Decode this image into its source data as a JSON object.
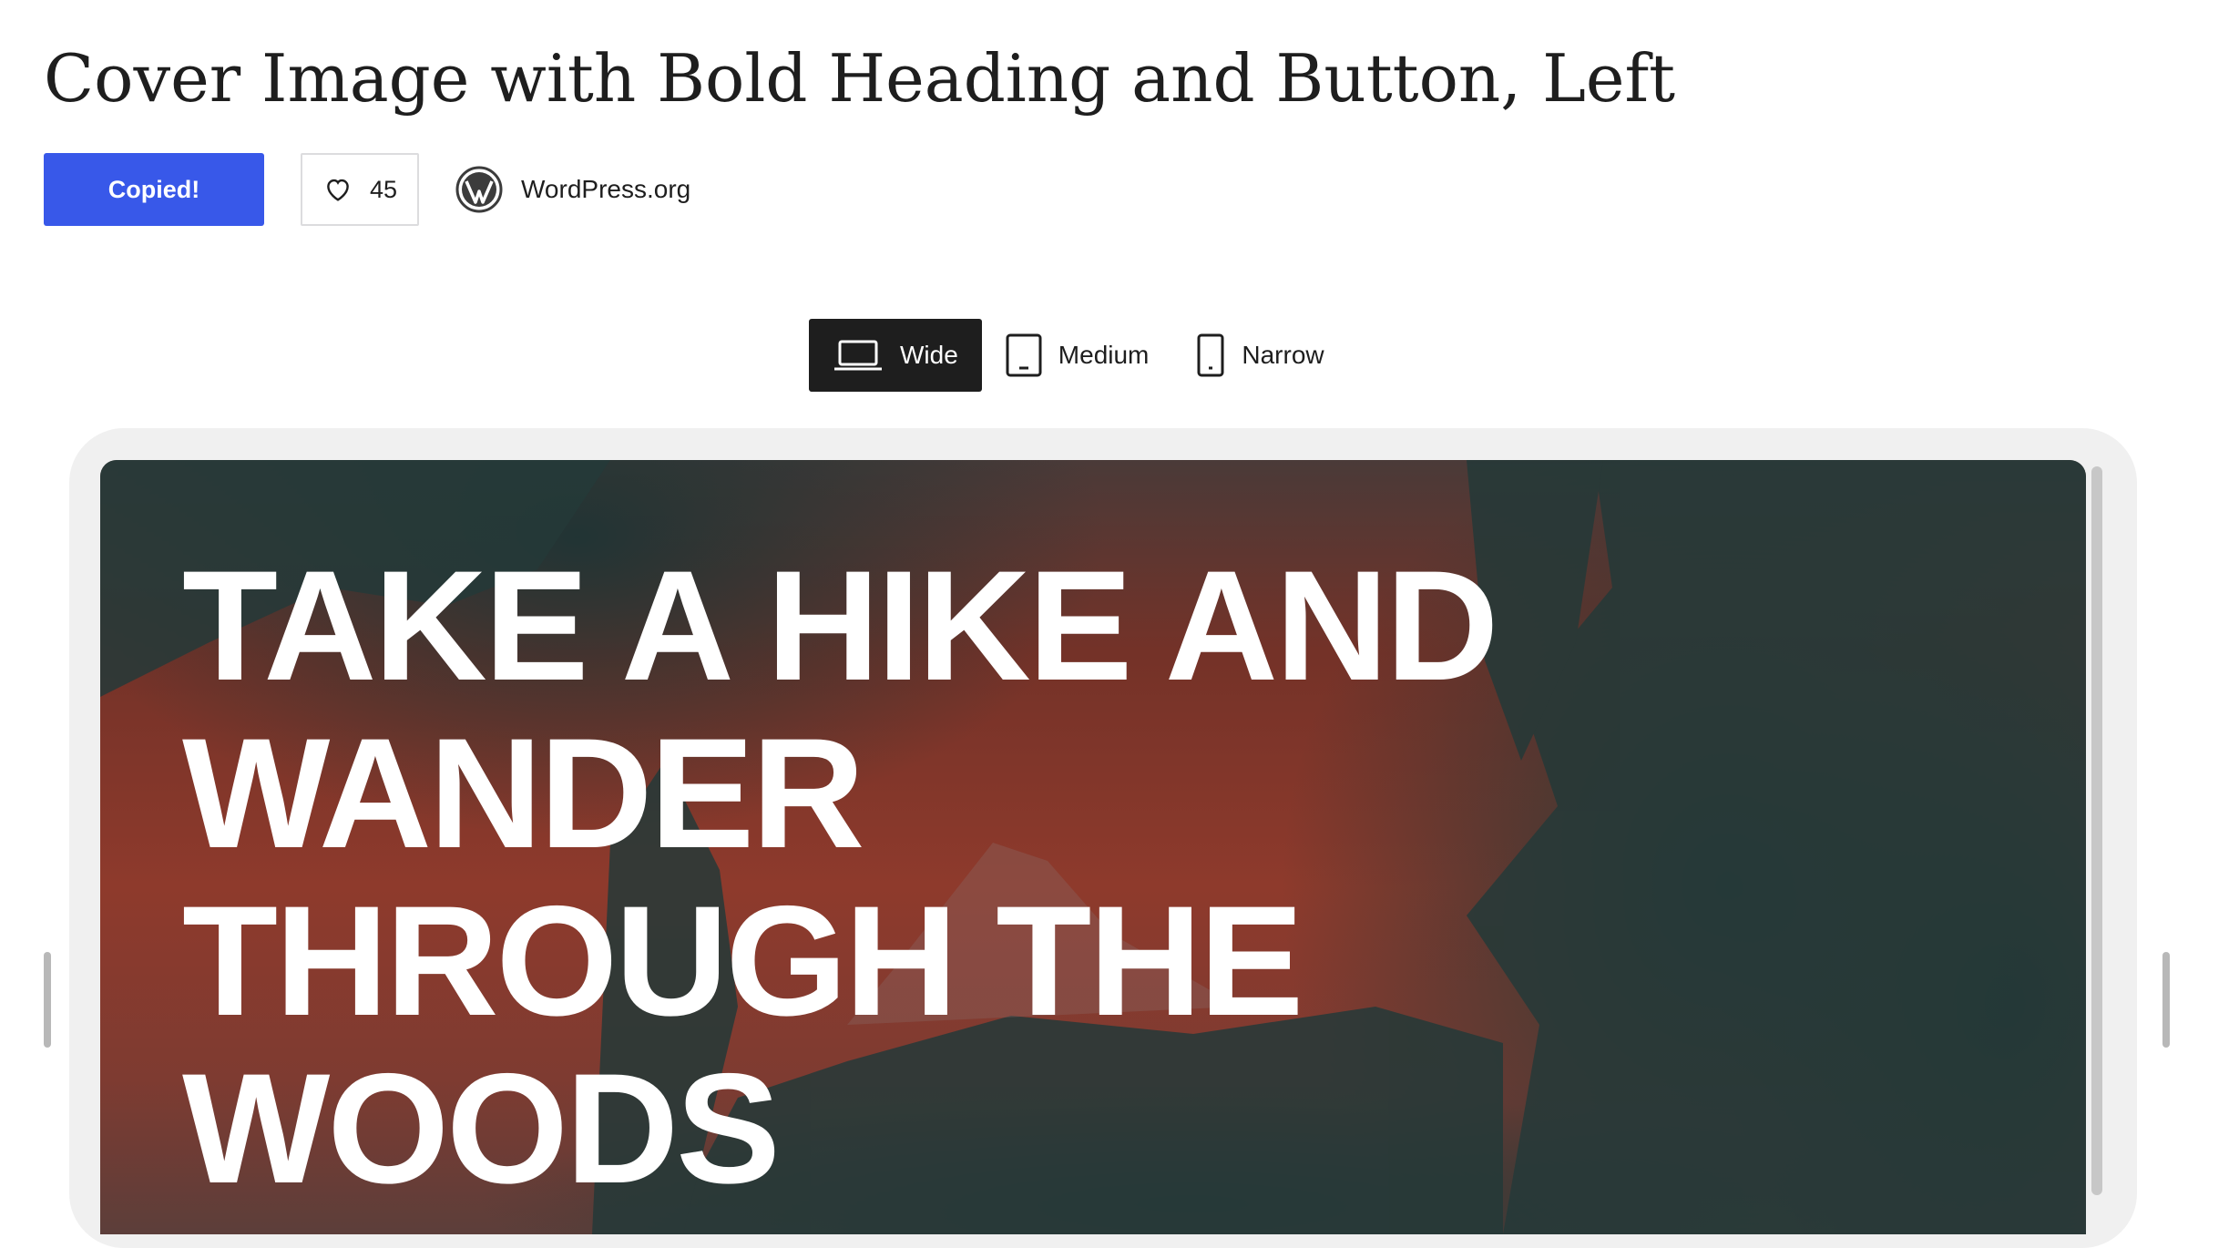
{
  "header": {
    "title": "Cover Image with Bold Heading and Button, Left"
  },
  "actions": {
    "copy_label": "Copied!",
    "like_count": "45",
    "author": "WordPress.org"
  },
  "viewport": {
    "options": [
      {
        "label": "Wide",
        "icon": "laptop-icon",
        "active": true
      },
      {
        "label": "Medium",
        "icon": "tablet-icon",
        "active": false
      },
      {
        "label": "Narrow",
        "icon": "mobile-icon",
        "active": false
      }
    ]
  },
  "preview": {
    "heading": "TAKE A HIKE AND\nWANDER\nTHROUGH THE\nWOODS"
  },
  "colors": {
    "accent": "#3858e9",
    "active_tab": "#1e1e1e",
    "overlay": "#8e3a2c"
  }
}
